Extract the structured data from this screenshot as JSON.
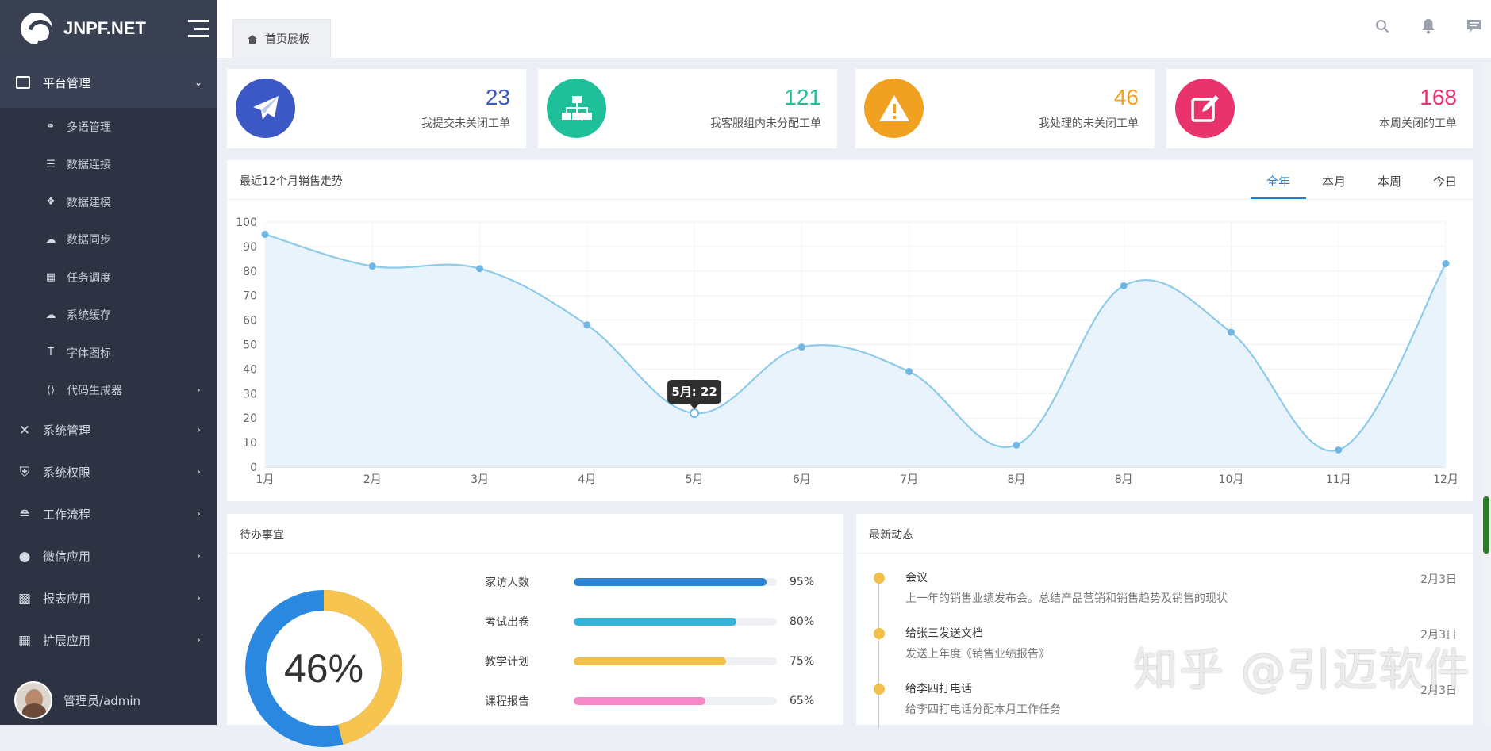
{
  "app": {
    "brand": "JNPF.NET"
  },
  "sidebar": {
    "group": {
      "label": "平台管理"
    },
    "sub_items": [
      {
        "label": "多语管理",
        "icon": "globe-icon"
      },
      {
        "label": "数据连接",
        "icon": "sliders-icon"
      },
      {
        "label": "数据建模",
        "icon": "cubes-icon"
      },
      {
        "label": "数据同步",
        "icon": "cloud-icon"
      },
      {
        "label": "任务调度",
        "icon": "calendar-icon"
      },
      {
        "label": "系统缓存",
        "icon": "cloud-download-icon"
      },
      {
        "label": "字体图标",
        "icon": "font-icon"
      },
      {
        "label": "代码生成器",
        "icon": "code-icon"
      }
    ],
    "items": [
      {
        "label": "系统管理",
        "icon": "tools-icon"
      },
      {
        "label": "系统权限",
        "icon": "shield-icon"
      },
      {
        "label": "工作流程",
        "icon": "share-icon"
      },
      {
        "label": "微信应用",
        "icon": "wechat-icon"
      },
      {
        "label": "报表应用",
        "icon": "bar-chart-icon"
      },
      {
        "label": "扩展应用",
        "icon": "grid-icon"
      }
    ],
    "user": "管理员/admin"
  },
  "topbar": {
    "tab_label": "首页展板"
  },
  "stats": [
    {
      "value": "23",
      "label": "我提交未关闭工单",
      "color": "#3b58c4",
      "icon": "paper-plane-icon"
    },
    {
      "value": "121",
      "label": "我客服组内未分配工单",
      "color": "#1fbf99",
      "icon": "sitemap-icon"
    },
    {
      "value": "46",
      "label": "我处理的未关闭工单",
      "color": "#f0a122",
      "icon": "warning-icon"
    },
    {
      "value": "168",
      "label": "本周关闭的工单",
      "color": "#e8336d",
      "icon": "edit-icon"
    }
  ],
  "trend": {
    "title": "最近12个月销售走势",
    "ranges": [
      "全年",
      "本月",
      "本周",
      "今日"
    ],
    "active_range": "全年",
    "tooltip": "5月: 22"
  },
  "chart_data": {
    "type": "area",
    "categories": [
      "1月",
      "2月",
      "3月",
      "4月",
      "5月",
      "6月",
      "7月",
      "8月",
      "8月",
      "10月",
      "11月",
      "12月"
    ],
    "values": [
      95,
      82,
      81,
      58,
      22,
      49,
      39,
      9,
      74,
      55,
      7,
      83
    ],
    "ylim": [
      0,
      100
    ],
    "yticks": [
      0,
      10,
      20,
      30,
      40,
      50,
      60,
      70,
      80,
      90,
      100
    ],
    "grid": true,
    "color": "#8ecbea"
  },
  "todo": {
    "title": "待办事宜",
    "donut_value": "46%",
    "donut_fraction": 0.46,
    "rows": [
      {
        "label": "家访人数",
        "pct": "95%",
        "value": 95,
        "color": "#2b84d6"
      },
      {
        "label": "考试出卷",
        "pct": "80%",
        "value": 80,
        "color": "#35b4d8"
      },
      {
        "label": "教学计划",
        "pct": "75%",
        "value": 75,
        "color": "#f2c04a"
      },
      {
        "label": "课程报告",
        "pct": "65%",
        "value": 65,
        "color": "#f588c6"
      }
    ]
  },
  "news": {
    "title": "最新动态",
    "items": [
      {
        "title": "会议",
        "desc": "上一年的销售业绩发布会。总结产品营销和销售趋势及销售的现状",
        "date": "2月3日"
      },
      {
        "title": "给张三发送文档",
        "desc": "发送上年度《销售业绩报告》",
        "date": "2月3日"
      },
      {
        "title": "给李四打电话",
        "desc": "给李四打电话分配本月工作任务",
        "date": "2月3日"
      }
    ]
  },
  "watermark": "知乎 @引迈软件"
}
